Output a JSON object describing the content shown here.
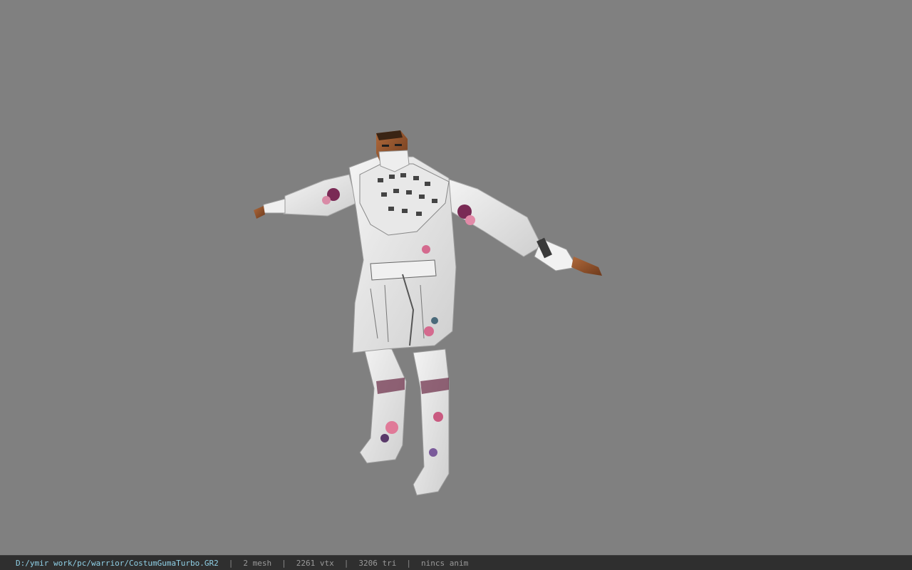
{
  "status": {
    "path": "D:/ymir work/pc/warrior/CostumGumaTurbo.GR2",
    "separator": "|",
    "mesh": "2 mesh",
    "vtx": "2261 vtx",
    "tri": "3206 tri",
    "anim": "nincs anim"
  },
  "colors": {
    "viewport_bg": "#808080",
    "statusbar_bg": "#2f2f2f",
    "path_color": "#8fd0e6",
    "stat_color": "#9a9a9a"
  }
}
